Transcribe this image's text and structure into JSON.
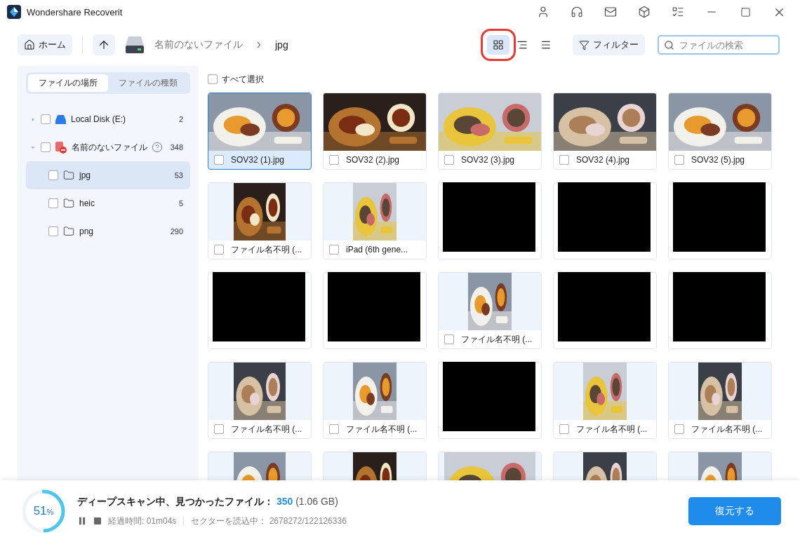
{
  "window": {
    "title": "Wondershare Recoverit"
  },
  "toolbar": {
    "home": "ホーム",
    "breadcrumb": [
      "名前のないファイル",
      "jpg"
    ],
    "views": [
      {
        "kind": "grid",
        "selected": true,
        "highlighted": true
      },
      {
        "kind": "detail",
        "selected": false,
        "highlighted": false
      },
      {
        "kind": "list",
        "selected": false,
        "highlighted": false
      }
    ],
    "filter": "フィルター",
    "search": {
      "placeholder": "ファイルの検索"
    }
  },
  "sidebar": {
    "tabs": [
      {
        "label": "ファイルの場所",
        "selected": true
      },
      {
        "label": "ファイルの種類",
        "selected": false
      }
    ],
    "tree": [
      {
        "kind": "drive",
        "label": "Local Disk (E:)",
        "count": "2",
        "expanded": false,
        "checked": false,
        "selected": false,
        "help": false
      },
      {
        "kind": "lost",
        "label": "名前のないファイル",
        "count": "348",
        "expanded": true,
        "checked": false,
        "selected": false,
        "help": true,
        "children": [
          {
            "kind": "folder",
            "label": "jpg",
            "count": "53",
            "checked": false,
            "selected": true
          },
          {
            "kind": "folder",
            "label": "heic",
            "count": "5",
            "checked": false,
            "selected": false
          },
          {
            "kind": "folder",
            "label": "png",
            "count": "290",
            "checked": false,
            "selected": false
          }
        ]
      }
    ]
  },
  "grid": {
    "select_all": {
      "label": "すべて選択",
      "checked": false
    },
    "cards": [
      {
        "kind": "wide",
        "label": "SOV32 (1).jpg",
        "checked": false,
        "selected": true
      },
      {
        "kind": "wide",
        "label": "SOV32 (2).jpg",
        "checked": false,
        "selected": false
      },
      {
        "kind": "wide",
        "label": "SOV32 (3).jpg",
        "checked": false,
        "selected": false
      },
      {
        "kind": "wide",
        "label": "SOV32 (4).jpg",
        "checked": false,
        "selected": false
      },
      {
        "kind": "wide",
        "label": "SOV32 (5).jpg",
        "checked": false,
        "selected": false
      },
      {
        "kind": "tall",
        "label": "ファイル名不明 (...",
        "checked": false,
        "selected": false
      },
      {
        "kind": "tall",
        "label": "iPad (6th gene...",
        "checked": false,
        "selected": false
      },
      {
        "kind": "redacted"
      },
      {
        "kind": "redacted"
      },
      {
        "kind": "redacted"
      },
      {
        "kind": "redacted"
      },
      {
        "kind": "redacted"
      },
      {
        "kind": "tall",
        "label": "ファイル名不明 (...",
        "checked": false,
        "selected": false
      },
      {
        "kind": "redacted"
      },
      {
        "kind": "redacted"
      },
      {
        "kind": "tall",
        "label": "ファイル名不明 (...",
        "checked": false,
        "selected": false
      },
      {
        "kind": "tall",
        "label": "ファイル名不明 (...",
        "checked": false,
        "selected": false
      },
      {
        "kind": "redacted"
      },
      {
        "kind": "tall",
        "label": "ファイル名不明 (...",
        "checked": false,
        "selected": false
      },
      {
        "kind": "tall",
        "label": "ファイル名不明 (...",
        "checked": false,
        "selected": false
      },
      {
        "kind": "tall"
      },
      {
        "kind": "tall"
      },
      {
        "kind": "wide"
      },
      {
        "kind": "tall"
      },
      {
        "kind": "tall"
      }
    ]
  },
  "status": {
    "progress": {
      "percent": "51",
      "unit": "%"
    },
    "headline": "ディープスキャン中、見つかったファイル：",
    "found": "350",
    "size": "(1.06 GB)",
    "elapsed": "経過時間: 01m04s",
    "sectors": "セクターを読込中： 2678272/122126336",
    "restore": "復元する"
  }
}
